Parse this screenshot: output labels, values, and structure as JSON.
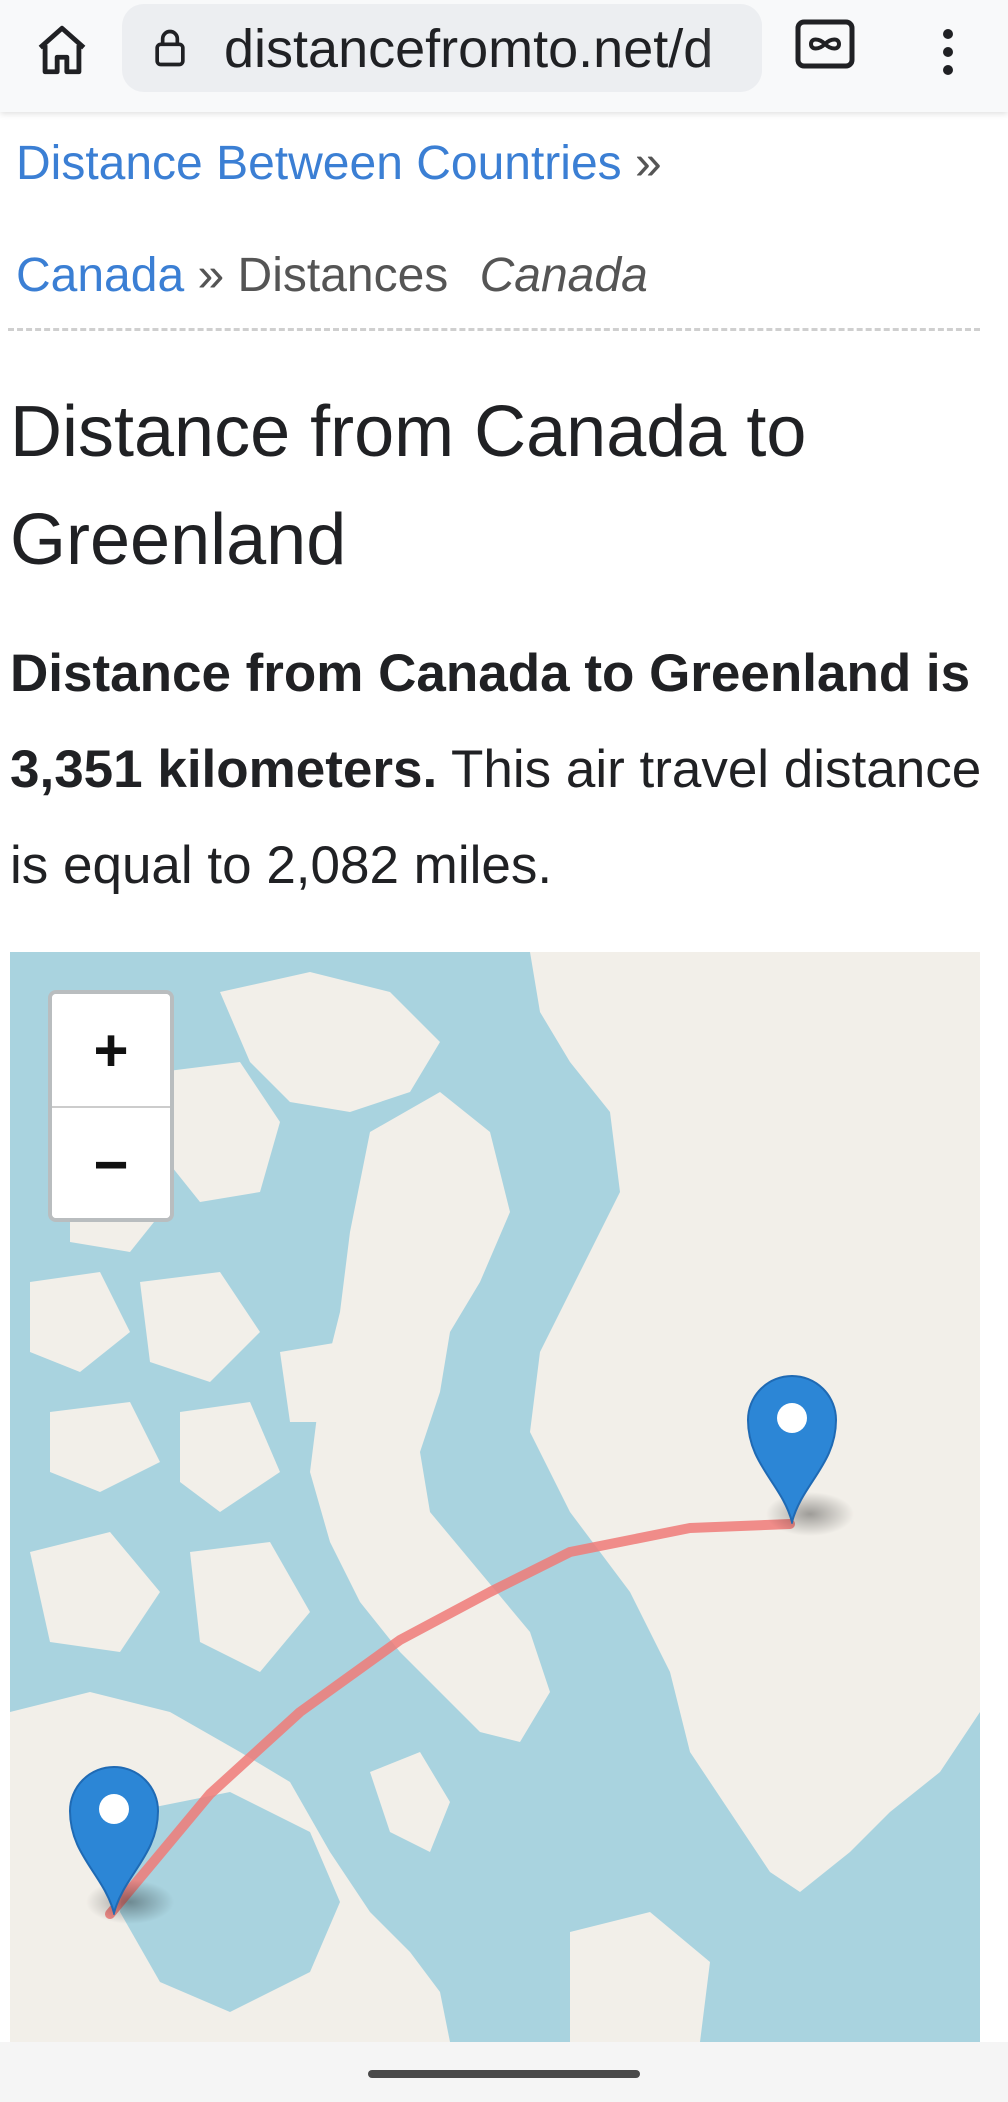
{
  "browser": {
    "url_text": "distancefromto.net/d",
    "icons": {
      "home": "home-icon",
      "lock": "lock-icon",
      "tabs": "incognito-tabs-icon",
      "menu": "more-vert-icon"
    }
  },
  "breadcrumb": {
    "root_link": "Distance Between Countries",
    "sep1": "»",
    "country_link": "Canada",
    "sep2": "»",
    "section": "Distances",
    "italic": "Canada"
  },
  "page": {
    "title": "Distance from Canada to Greenland",
    "summary_bold": "Distance from Canada to Greenland is 3,351 kilometers.",
    "summary_rest": " This air travel distance is equal to 2,082 miles."
  },
  "map": {
    "zoom_in_label": "+",
    "zoom_out_label": "−",
    "colors": {
      "water": "#a9d3df",
      "land": "#f2efe9",
      "route": "#f07a78",
      "marker": "#2c86d6"
    },
    "markers": [
      "Canada",
      "Greenland"
    ]
  },
  "colors": {
    "link": "#3b7fd4",
    "text": "#202124"
  }
}
